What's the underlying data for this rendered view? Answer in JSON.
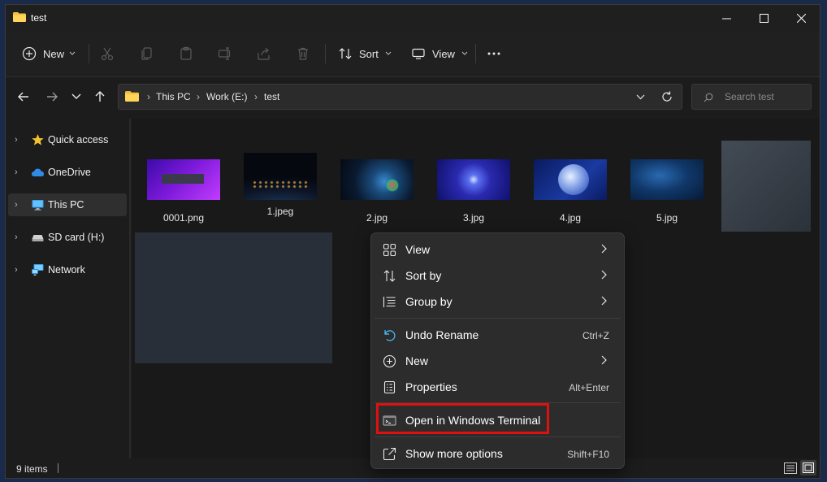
{
  "window": {
    "title": "test"
  },
  "toolbar": {
    "new_label": "New",
    "sort_label": "Sort",
    "view_label": "View"
  },
  "address": {
    "crumbs": [
      "This PC",
      "Work (E:)",
      "test"
    ],
    "search_placeholder": "Search test"
  },
  "navpane": {
    "items": [
      {
        "label": "Quick access"
      },
      {
        "label": "OneDrive"
      },
      {
        "label": "This PC"
      },
      {
        "label": "SD card (H:)"
      },
      {
        "label": "Network"
      }
    ]
  },
  "files": [
    {
      "name": "0001.png"
    },
    {
      "name": "1.jpeg"
    },
    {
      "name": "2.jpg"
    },
    {
      "name": "3.jpg"
    },
    {
      "name": "4.jpg"
    },
    {
      "name": "5.jpg"
    }
  ],
  "status": {
    "items": "9 items"
  },
  "context_menu": {
    "items": [
      {
        "label": "View",
        "shortcut": ""
      },
      {
        "label": "Sort by",
        "shortcut": ""
      },
      {
        "label": "Group by",
        "shortcut": ""
      },
      {
        "label": "Undo Rename",
        "shortcut": "Ctrl+Z"
      },
      {
        "label": "New",
        "shortcut": ""
      },
      {
        "label": "Properties",
        "shortcut": "Alt+Enter"
      },
      {
        "label": "Open in Windows Terminal",
        "shortcut": ""
      },
      {
        "label": "Show more options",
        "shortcut": "Shift+F10"
      }
    ]
  },
  "colors": {
    "highlight": "#e01010",
    "folder": "#f3c23c",
    "accent": "#4cc2ff"
  }
}
